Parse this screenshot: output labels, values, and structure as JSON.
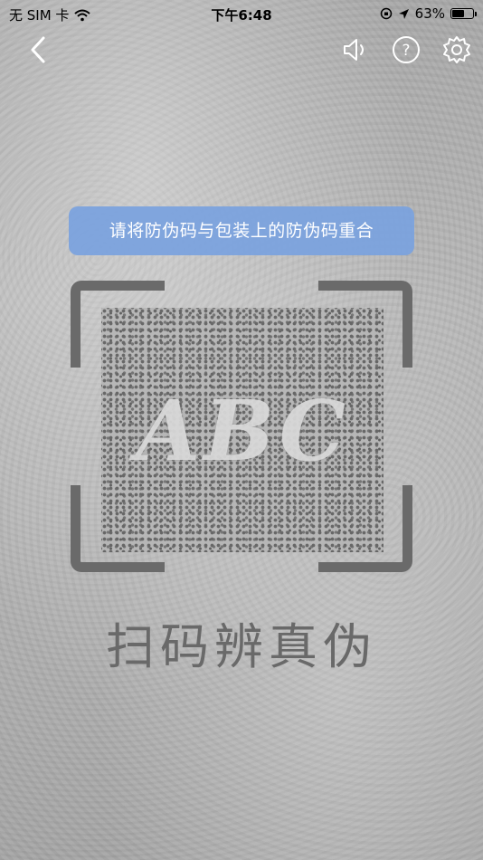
{
  "status_bar": {
    "carrier": "无 SIM 卡",
    "time": "下午6:48",
    "battery_percent_label": "63%",
    "battery_level": 0.63
  },
  "nav": {
    "back_icon": "chevron-left-icon",
    "icons": [
      "speaker-icon",
      "help-icon",
      "settings-icon"
    ]
  },
  "hint": {
    "text": "请将防伪码与包装上的防伪码重合"
  },
  "scan": {
    "pattern_text": "ABC"
  },
  "title": "扫码辨真伪",
  "colors": {
    "hint_bg": "#7aa2de",
    "frame": "#6a6a6a",
    "title": "#696969"
  }
}
